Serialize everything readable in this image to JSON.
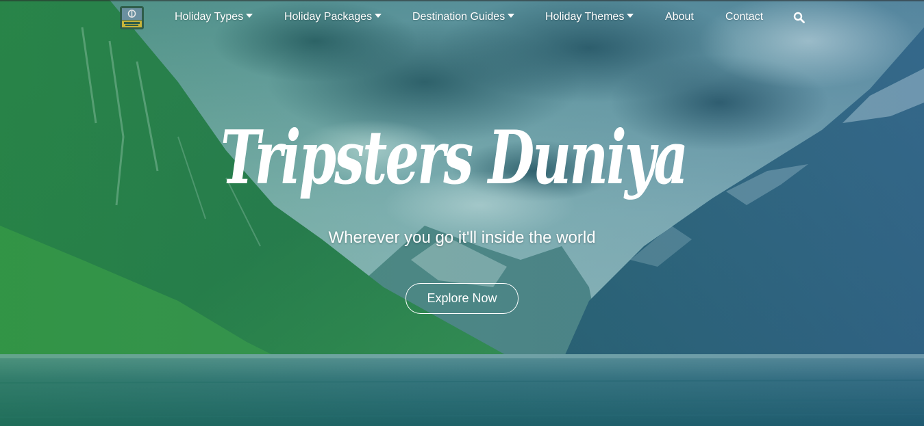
{
  "nav": {
    "logo_icon": "tripsters-duniya-logo",
    "items": [
      {
        "label": "Holiday Types",
        "has_dropdown": true
      },
      {
        "label": "Holiday Packages",
        "has_dropdown": true
      },
      {
        "label": "Destination Guides",
        "has_dropdown": true
      },
      {
        "label": "Holiday Themes",
        "has_dropdown": true
      },
      {
        "label": "About",
        "has_dropdown": false
      },
      {
        "label": "Contact",
        "has_dropdown": false
      }
    ],
    "search_icon": "search-icon"
  },
  "hero": {
    "title": "Tripsters Duniya",
    "tagline": "Wherever you go it'll inside the world",
    "cta_label": "Explore Now"
  },
  "colors": {
    "text": "#ffffff",
    "overlay_green": "#1e8c46",
    "overlay_blue": "#1e5a8c"
  }
}
